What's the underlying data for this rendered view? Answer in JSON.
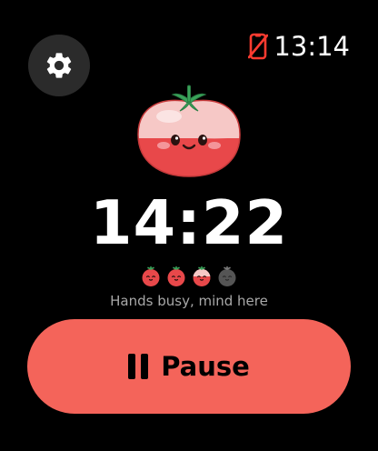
{
  "status_bar": {
    "time": "13:14",
    "connection_icon": "phone-disconnected-icon"
  },
  "settings": {
    "icon": "gear-icon"
  },
  "mascot": {
    "icon": "tomato-mascot-icon"
  },
  "timer": {
    "remaining": "14:22"
  },
  "sessions": {
    "total": 4,
    "completed": 3,
    "in_progress_index": 2
  },
  "tagline": "Hands busy, mind here",
  "pause_button": {
    "label": "Pause",
    "icon": "pause-icon"
  },
  "colors": {
    "accent": "#f4645a",
    "tomato": "#e8484a",
    "background": "#000000",
    "status_alert": "#ff3b30"
  }
}
